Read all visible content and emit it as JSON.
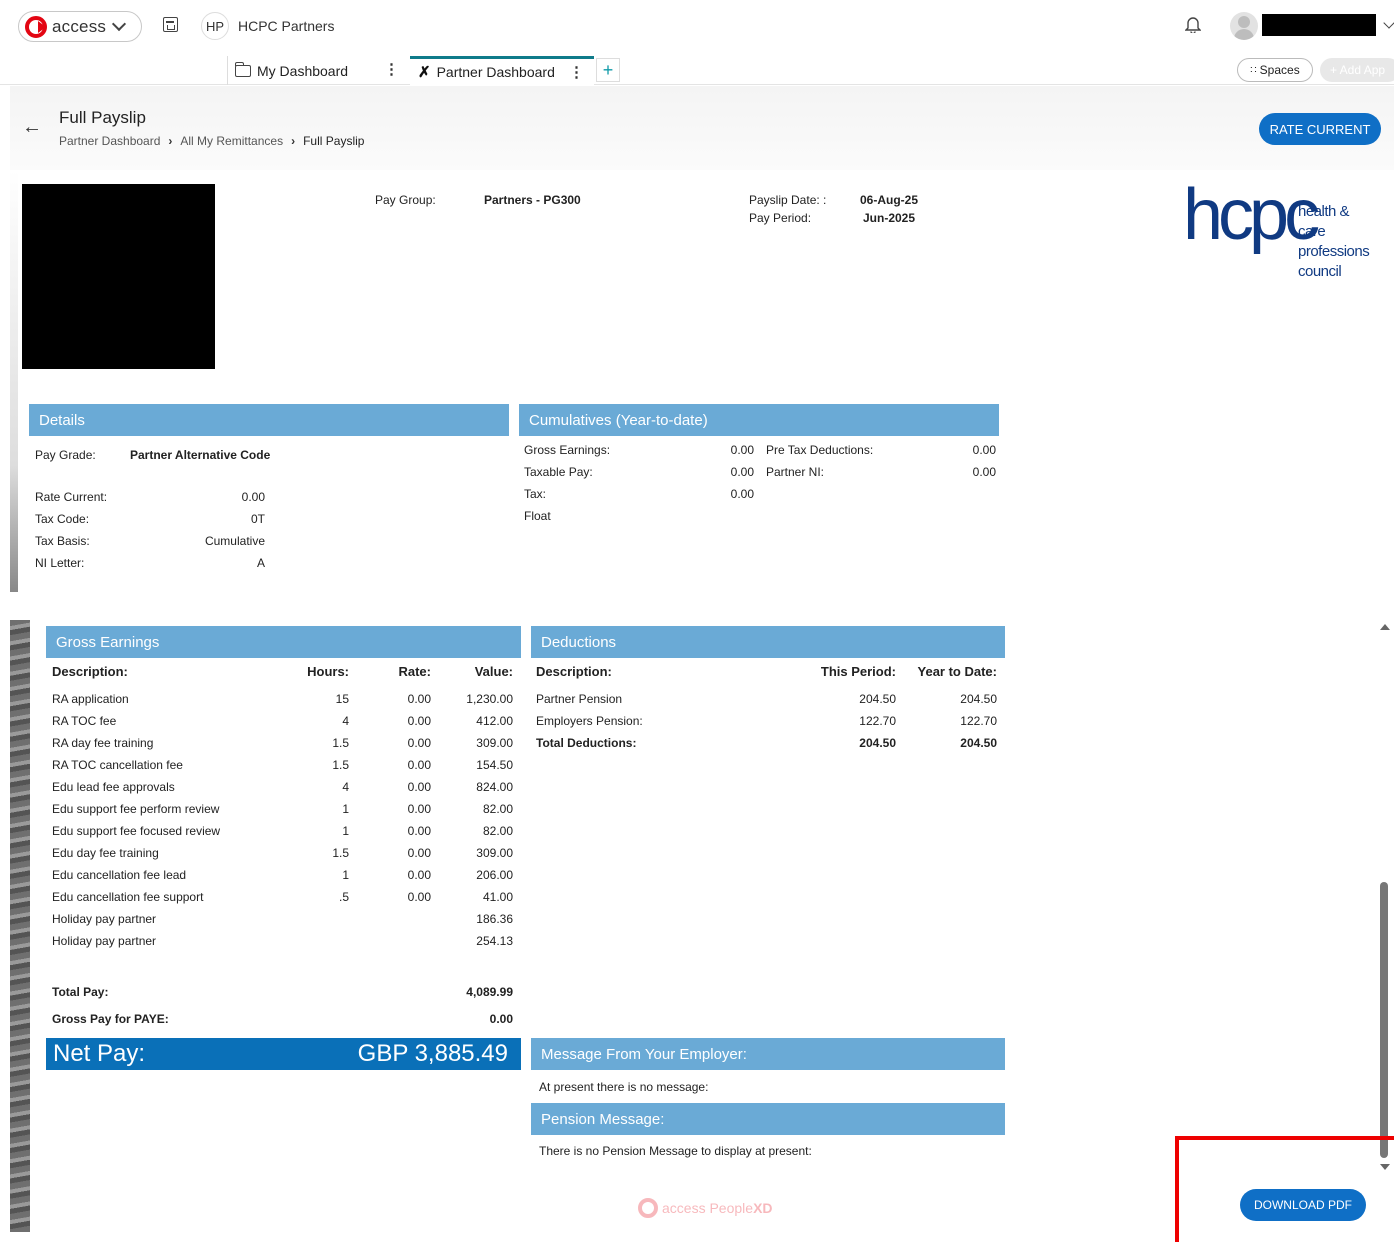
{
  "topbar": {
    "app_name": "access",
    "org_initials": "HP",
    "org_name": "HCPC Partners"
  },
  "tabs": [
    {
      "label": "My Dashboard"
    },
    {
      "label": "Partner Dashboard"
    }
  ],
  "header_actions": {
    "spaces": "Spaces",
    "add_app": "+ Add App"
  },
  "page": {
    "title": "Full Payslip",
    "breadcrumb": [
      "Partner Dashboard",
      "All My Remittances",
      "Full Payslip"
    ],
    "rate_button": "RATE CURRENT"
  },
  "payslip": {
    "pay_group_label": "Pay Group:",
    "pay_group_value": "Partners - PG300",
    "payslip_date_label": "Payslip Date: :",
    "payslip_date_value": "06-Aug-25",
    "pay_period_label": "Pay Period:",
    "pay_period_value": "Jun-2025",
    "logo_text": "hcpc",
    "logo_sub": [
      "health & care",
      "professions",
      "council"
    ]
  },
  "details": {
    "title": "Details",
    "pay_grade_label": "Pay Grade:",
    "pay_grade_value": "Partner Alternative Code",
    "rows": [
      {
        "label": "Rate Current:",
        "value": "0.00"
      },
      {
        "label": "Tax Code:",
        "value": "0T"
      },
      {
        "label": "Tax Basis:",
        "value": "Cumulative"
      },
      {
        "label": "NI Letter:",
        "value": "A"
      }
    ]
  },
  "cumulatives": {
    "title": "Cumulatives (Year-to-date)",
    "left": [
      {
        "label": "Gross Earnings:",
        "value": "0.00"
      },
      {
        "label": "Taxable Pay:",
        "value": "0.00"
      },
      {
        "label": "Tax:",
        "value": "0.00"
      },
      {
        "label": "Float",
        "value": ""
      }
    ],
    "right": [
      {
        "label": "Pre Tax Deductions:",
        "value": "0.00"
      },
      {
        "label": "Partner NI:",
        "value": "0.00"
      }
    ]
  },
  "earnings": {
    "title": "Gross Earnings",
    "headers": {
      "desc": "Description:",
      "hours": "Hours:",
      "rate": "Rate:",
      "value": "Value:"
    },
    "rows": [
      {
        "desc": "RA application",
        "hours": "15",
        "rate": "0.00",
        "value": "1,230.00"
      },
      {
        "desc": "RA TOC fee",
        "hours": "4",
        "rate": "0.00",
        "value": "412.00"
      },
      {
        "desc": "RA day fee training",
        "hours": "1.5",
        "rate": "0.00",
        "value": "309.00"
      },
      {
        "desc": "RA TOC cancellation fee",
        "hours": "1.5",
        "rate": "0.00",
        "value": "154.50"
      },
      {
        "desc": "Edu lead fee approvals",
        "hours": "4",
        "rate": "0.00",
        "value": "824.00"
      },
      {
        "desc": "Edu support fee perform review",
        "hours": "1",
        "rate": "0.00",
        "value": "82.00"
      },
      {
        "desc": "Edu support fee focused review",
        "hours": "1",
        "rate": "0.00",
        "value": "82.00"
      },
      {
        "desc": "Edu day fee training",
        "hours": "1.5",
        "rate": "0.00",
        "value": "309.00"
      },
      {
        "desc": "Edu cancellation fee lead",
        "hours": "1",
        "rate": "0.00",
        "value": "206.00"
      },
      {
        "desc": "Edu cancellation fee support",
        "hours": ".5",
        "rate": "0.00",
        "value": "41.00"
      },
      {
        "desc": "Holiday pay partner",
        "hours": "",
        "rate": "",
        "value": "186.36"
      },
      {
        "desc": "Holiday pay partner",
        "hours": "",
        "rate": "",
        "value": "254.13"
      }
    ],
    "total_pay_label": "Total Pay:",
    "total_pay_value": "4,089.99",
    "gross_paye_label": "Gross Pay for PAYE:",
    "gross_paye_value": "0.00",
    "net_pay_label": "Net Pay:",
    "net_pay_value": "GBP 3,885.49"
  },
  "deductions": {
    "title": "Deductions",
    "headers": {
      "desc": "Description:",
      "period": "This Period:",
      "ytd": "Year to Date:"
    },
    "rows": [
      {
        "desc": "Partner Pension",
        "period": "204.50",
        "ytd": "204.50",
        "bold": false
      },
      {
        "desc": "Employers Pension:",
        "period": "122.70",
        "ytd": "122.70",
        "bold": false
      },
      {
        "desc": "Total Deductions:",
        "period": "204.50",
        "ytd": "204.50",
        "bold": true
      }
    ]
  },
  "messages": {
    "employer_title": "Message From Your Employer:",
    "employer_text": "At present there is no message:",
    "pension_title": "Pension Message:",
    "pension_text": "There is no Pension Message to display at present:"
  },
  "footer": {
    "brand": "access",
    "product": "People",
    "product_suffix": "XD",
    "download_button": "DOWNLOAD PDF"
  },
  "colors": {
    "section_header": "#6aaad6",
    "net_pay_bar": "#0a70b8",
    "primary_button": "#0f6fc6",
    "brand_red": "#e30613",
    "hcpc_blue": "#103a82",
    "highlight_box": "#ee0000"
  }
}
